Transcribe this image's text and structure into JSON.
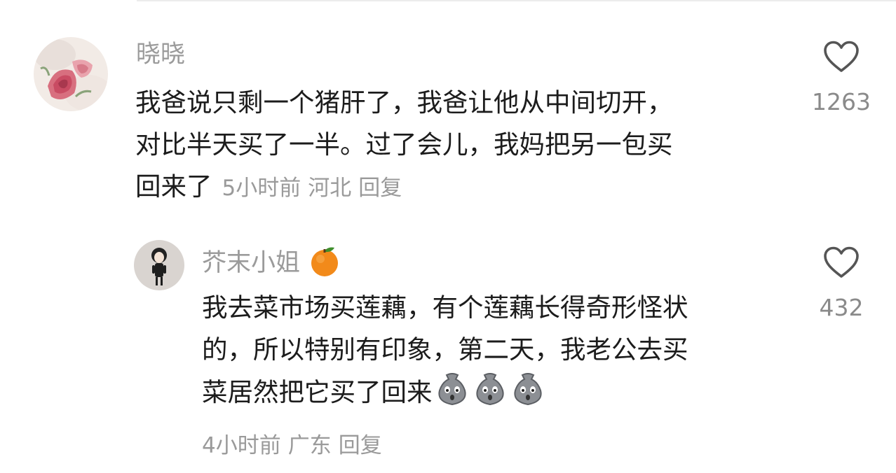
{
  "comment": {
    "username": "晓晓",
    "lines": [
      "我爸说只剩一个猪肝了，我爸让他从中间切开，",
      "对比半天买了一半。过了会儿，我妈把另一包买",
      "回来了"
    ],
    "time": "5小时前",
    "location": "河北",
    "reply_label": "回复",
    "like_count": "1263"
  },
  "reply": {
    "username": "芥末小姐",
    "username_badge_icon": "orange-emoji-icon",
    "lines": [
      "我去菜市场买莲藕，有个莲藕长得奇形怪状",
      "的，所以特别有印象，第二天，我老公去买",
      "菜居然把它买了回来"
    ],
    "emoji_icon": "shocked-sack-emoji-icon",
    "emoji_count": 3,
    "time": "4小时前",
    "location": "广东",
    "reply_label": "回复",
    "like_count": "432"
  },
  "colors": {
    "username": "#9b9b9b",
    "body_text": "#1c1c1c",
    "meta_text": "#9a9a9a",
    "like_icon": "#555555"
  }
}
